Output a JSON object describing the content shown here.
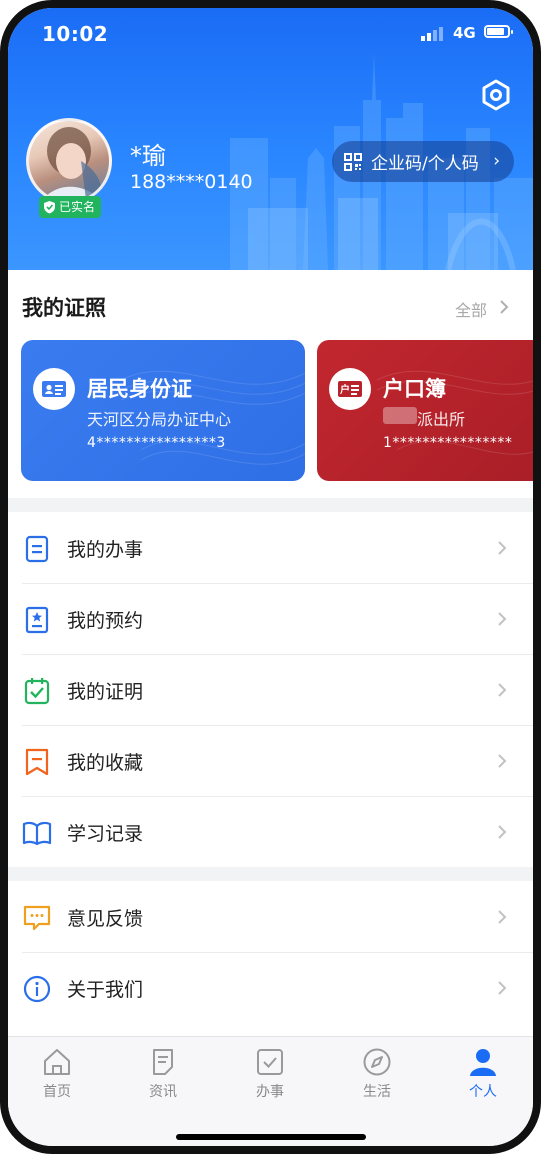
{
  "status_bar": {
    "time": "10:02",
    "network": "4G"
  },
  "profile": {
    "name": "*瑜",
    "phone": "188****0140",
    "verified_label": "已实名",
    "qr_button": "企业码/个人码"
  },
  "certificates": {
    "title": "我的证照",
    "all_label": "全部",
    "cards": [
      {
        "title": "居民身份证",
        "subtitle": "天河区分局办证中心",
        "number": "4****************3",
        "badge_text": ""
      },
      {
        "title": "户口簿",
        "subtitle": "派出所",
        "number": "1****************",
        "badge_text": "户"
      }
    ]
  },
  "menu_group_1": [
    {
      "label": "我的办事",
      "icon": "document-icon",
      "color": "#2b6fe8"
    },
    {
      "label": "我的预约",
      "icon": "appointment-icon",
      "color": "#2b6fe8"
    },
    {
      "label": "我的证明",
      "icon": "certificate-check-icon",
      "color": "#22b35e"
    },
    {
      "label": "我的收藏",
      "icon": "bookmark-icon",
      "color": "#f0641e"
    },
    {
      "label": "学习记录",
      "icon": "book-icon",
      "color": "#2b6fe8"
    }
  ],
  "menu_group_2": [
    {
      "label": "意见反馈",
      "icon": "feedback-icon",
      "color": "#f0a020"
    },
    {
      "label": "关于我们",
      "icon": "info-icon",
      "color": "#2b6fe8"
    }
  ],
  "tab_bar": [
    {
      "label": "首页",
      "icon": "home-icon",
      "active": false
    },
    {
      "label": "资讯",
      "icon": "news-icon",
      "active": false
    },
    {
      "label": "办事",
      "icon": "task-check-icon",
      "active": false
    },
    {
      "label": "生活",
      "icon": "compass-icon",
      "active": false
    },
    {
      "label": "个人",
      "icon": "person-icon",
      "active": true
    }
  ],
  "colors": {
    "brand": "#1a6cf5",
    "id_card": "#3a7cf0",
    "hukou_card": "#b8222b",
    "verified": "#22b35e"
  }
}
